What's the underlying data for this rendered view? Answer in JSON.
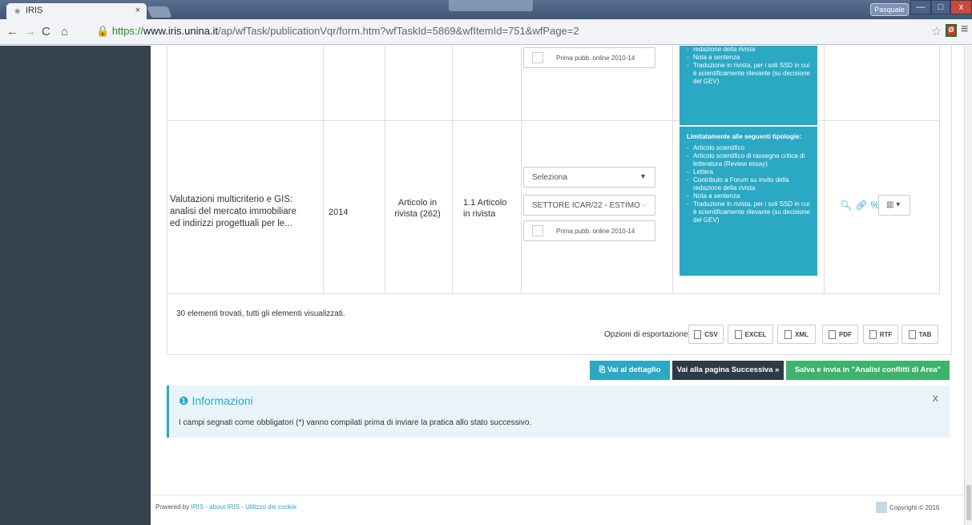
{
  "browser": {
    "tab_title": "IRIS",
    "url_scheme": "https://",
    "url_host": "www.iris.unina.it",
    "url_path": "/ap/wfTask/publicationVqr/form.htm?wfTaskId=5869&wfItemId=751&wfPage=2",
    "profile": "Pasquale"
  },
  "row_top": {
    "checkbox_label": "Prima pubb. online 2010-14",
    "info_items": [
      "redazione della rivista",
      "Nota a sentenza",
      "Traduzione in rivista, per i soli SSD in cui è scientificamente rilevante (su decisione del GEV)"
    ]
  },
  "row": {
    "title": "Valutazioni multicriterio e GIS: analisi del mercato immobiliare ed indirizzi progettuali per le...",
    "year": "2014",
    "type": "Articolo in rivista (262)",
    "category": "1.1 Articolo in rivista",
    "select_placeholder": "Seleziona",
    "sector": "SETTORE ICAR/22 - ESTIMO",
    "checkbox_label": "Prima pubb. online 2010-14",
    "info_title": "Limitatamente alle seguenti tipologie:",
    "info_items": [
      "Articolo scientifico",
      "Articolo scientifico di rassegna critica di letteratura (Review essay)",
      "Lettera",
      "Contributo a Forum su invito della redazione della rivista",
      "Nota a sentenza",
      "Traduzione in rivista, per i soli SSD in cui è scientificamente rilevante (su decisione del GEV)"
    ]
  },
  "results_text": "30 elementi trovati, tutti gli elementi visualizzati.",
  "export": {
    "label": "Opzioni di esportazione:",
    "formats": [
      "CSV",
      "EXCEL",
      "XML",
      "PDF",
      "RTF",
      "TAB"
    ]
  },
  "buttons": {
    "detail": "Vai al dettaglio",
    "next": "Vai alla pagina Successiva",
    "save": "Salva e invia in \"Analisi conflitti di Area\""
  },
  "info": {
    "title": "Informazioni",
    "text": "I campi segnati come obbligatori (*) vanno compilati prima di inviare la pratica allo stato successivo.",
    "close": "X"
  },
  "footer": {
    "powered": "Powered by",
    "iris": "IRIS",
    "about": "about IRIS",
    "cookie": "Utilizzo dei cookie",
    "copyright": "Copyright © 2016"
  },
  "colors": {
    "accent": "#2aa8c4",
    "sidebar": "#34434d",
    "save_btn": "#3db36b",
    "next_btn": "#2d3b44"
  }
}
